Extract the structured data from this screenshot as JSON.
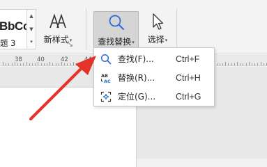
{
  "ribbon": {
    "style_gallery": {
      "sample_text": "BbCc",
      "style_name": "题 3",
      "scroll_up": "▲",
      "scroll_down": "▼",
      "expand": "▾"
    },
    "new_style": {
      "label": "新样式",
      "caret": "▾",
      "launcher": "↘",
      "icon": "font-style-AA-icon"
    },
    "find_replace": {
      "label": "查找替换",
      "caret": "▾",
      "icon": "magnifier-icon"
    },
    "select": {
      "label": "选择",
      "caret": "▾",
      "icon": "cursor-arrow-icon"
    }
  },
  "ruler": {
    "marks": [
      "38",
      "40",
      "42",
      "44"
    ]
  },
  "menu": {
    "items": [
      {
        "label": "查找(F)...",
        "shortcut": "Ctrl+F",
        "icon": "search-icon"
      },
      {
        "label": "替换(R)...",
        "shortcut": "Ctrl+H",
        "icon": "replace-icon"
      },
      {
        "label": "定位(G)...",
        "shortcut": "Ctrl+G",
        "icon": "goto-icon"
      }
    ]
  },
  "colors": {
    "accent_blue": "#2b6fd6",
    "arrow_red": "#e5332a"
  }
}
